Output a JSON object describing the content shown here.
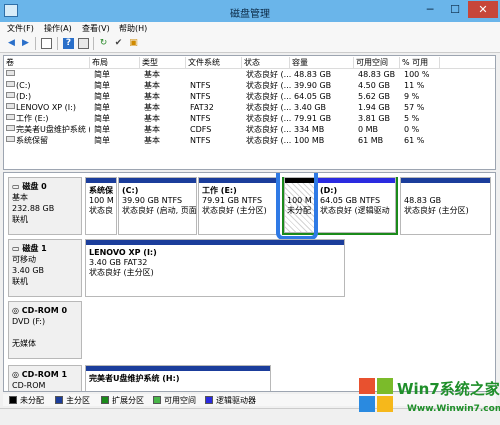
{
  "window": {
    "title": "磁盘管理",
    "minimize": "─",
    "maximize": "☐",
    "close": "✕"
  },
  "menu": [
    "文件(F)",
    "操作(A)",
    "查看(V)",
    "帮助(H)"
  ],
  "columns": [
    "卷",
    "布局",
    "类型",
    "文件系统",
    "状态",
    "容量",
    "可用空间",
    "% 可用"
  ],
  "volumes": [
    {
      "name": "",
      "layout": "简单",
      "type": "基本",
      "fs": "",
      "status": "状态良好 (...",
      "capacity": "48.83 GB",
      "free": "48.83 GB",
      "pct": "100 %"
    },
    {
      "name": "(C:)",
      "layout": "简单",
      "type": "基本",
      "fs": "NTFS",
      "status": "状态良好 (...",
      "capacity": "39.90 GB",
      "free": "4.50 GB",
      "pct": "11 %"
    },
    {
      "name": "(D:)",
      "layout": "简单",
      "type": "基本",
      "fs": "NTFS",
      "status": "状态良好 (...",
      "capacity": "64.05 GB",
      "free": "5.62 GB",
      "pct": "9 %"
    },
    {
      "name": "LENOVO XP (I:)",
      "layout": "简单",
      "type": "基本",
      "fs": "FAT32",
      "status": "状态良好 (...",
      "capacity": "3.40 GB",
      "free": "1.94 GB",
      "pct": "57 %"
    },
    {
      "name": "工作 (E:)",
      "layout": "简单",
      "type": "基本",
      "fs": "NTFS",
      "status": "状态良好 (...",
      "capacity": "79.91 GB",
      "free": "3.81 GB",
      "pct": "5 %"
    },
    {
      "name": "完美者U盘维护系统 (...",
      "layout": "简单",
      "type": "基本",
      "fs": "CDFS",
      "status": "状态良好 (...",
      "capacity": "334 MB",
      "free": "0 MB",
      "pct": "0 %"
    },
    {
      "name": "系统保留",
      "layout": "简单",
      "type": "基本",
      "fs": "NTFS",
      "status": "状态良好 (...",
      "capacity": "100 MB",
      "free": "61 MB",
      "pct": "61 %"
    }
  ],
  "disks": [
    {
      "name": "磁盘 0",
      "line1": "基本",
      "line2": "232.88 GB",
      "line3": "联机",
      "partitions": [
        {
          "title": "系统保",
          "size": "100 M",
          "status": "状态良"
        },
        {
          "title": "(C:)",
          "size": "39.90 GB NTFS",
          "status": "状态良好 (启动, 页面"
        },
        {
          "title": "工作  (E:)",
          "size": "79.91 GB NTFS",
          "status": "状态良好 (主分区)"
        },
        {
          "title": "",
          "size": "100 M",
          "status": "未分配"
        },
        {
          "title": "(D:)",
          "size": "64.05 GB NTFS",
          "status": "状态良好 (逻辑驱动"
        },
        {
          "title": "",
          "size": "48.83 GB",
          "status": "状态良好 (主分区)"
        }
      ]
    },
    {
      "name": "磁盘 1",
      "line1": "可移动",
      "line2": "3.40 GB",
      "line3": "联机",
      "partitions": [
        {
          "title": "LENOVO XP  (I:)",
          "size": "3.40 GB FAT32",
          "status": "状态良好 (主分区)"
        }
      ]
    },
    {
      "name": "CD-ROM 0",
      "line1": "DVD (F:)",
      "line2": "",
      "line3": "无媒体",
      "partitions": []
    },
    {
      "name": "CD-ROM 1",
      "line1": "CD-ROM",
      "line2": "",
      "line3": "",
      "partitions": [
        {
          "title": "完美者U盘维护系统  (H:)",
          "size": "",
          "status": ""
        }
      ]
    }
  ],
  "legend": [
    {
      "label": "未分配",
      "color": "#000000"
    },
    {
      "label": "主分区",
      "color": "#1b3d9b"
    },
    {
      "label": "扩展分区",
      "color": "#1a8a1a"
    },
    {
      "label": "可用空间",
      "color": "#49b649"
    },
    {
      "label": "逻辑驱动器",
      "color": "#2a2ae0"
    }
  ],
  "watermark": {
    "brand": "Win7系统之家",
    "url": "Www.Winwin7.com"
  },
  "colors": {
    "highlight": "#2f7ae5",
    "primary": "#1b3d9b",
    "extended": "#1a8a1a"
  }
}
